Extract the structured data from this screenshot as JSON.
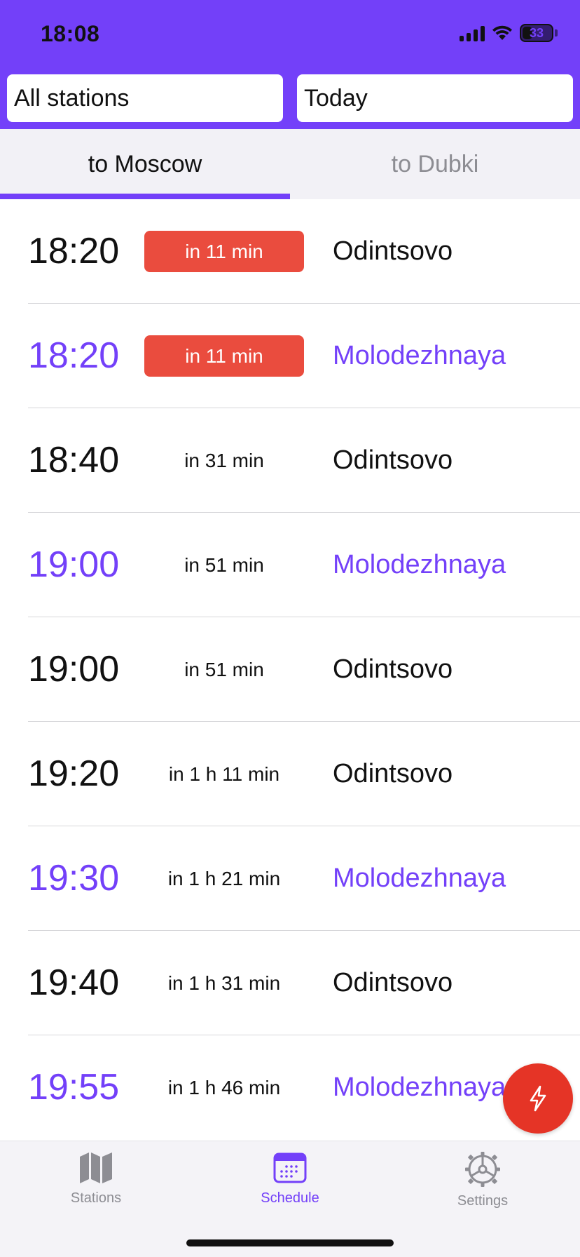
{
  "status_bar": {
    "time": "18:08",
    "battery": "33"
  },
  "filters": {
    "station": "All stations",
    "date": "Today"
  },
  "tabs": {
    "active": "to Moscow",
    "inactive": "to Dubki"
  },
  "departures": [
    {
      "time": "18:20",
      "eta": "in 11 min",
      "station": "Odintsovo",
      "urgent": true,
      "color": "black"
    },
    {
      "time": "18:20",
      "eta": "in 11 min",
      "station": "Molodezhnaya",
      "urgent": true,
      "color": "purple"
    },
    {
      "time": "18:40",
      "eta": "in 31 min",
      "station": "Odintsovo",
      "urgent": false,
      "color": "black"
    },
    {
      "time": "19:00",
      "eta": "in 51 min",
      "station": "Molodezhnaya",
      "urgent": false,
      "color": "purple"
    },
    {
      "time": "19:00",
      "eta": "in 51 min",
      "station": "Odintsovo",
      "urgent": false,
      "color": "black"
    },
    {
      "time": "19:20",
      "eta": "in 1 h 11 min",
      "station": "Odintsovo",
      "urgent": false,
      "color": "black"
    },
    {
      "time": "19:30",
      "eta": "in 1 h 21 min",
      "station": "Molodezhnaya",
      "urgent": false,
      "color": "purple"
    },
    {
      "time": "19:40",
      "eta": "in 1 h 31 min",
      "station": "Odintsovo",
      "urgent": false,
      "color": "black"
    },
    {
      "time": "19:55",
      "eta": "in 1 h 46 min",
      "station": "Molodezhnaya",
      "urgent": false,
      "color": "purple"
    }
  ],
  "fab": {
    "icon": "lightning-icon"
  },
  "tab_bar": [
    {
      "label": "Stations",
      "icon": "map-icon",
      "active": false
    },
    {
      "label": "Schedule",
      "icon": "calendar-icon",
      "active": true
    },
    {
      "label": "Settings",
      "icon": "gear-icon",
      "active": false
    }
  ],
  "colors": {
    "accent": "#7340f9",
    "urgent": "#ea4c3e",
    "fab": "#e53426",
    "inactive": "#8d8d93"
  }
}
